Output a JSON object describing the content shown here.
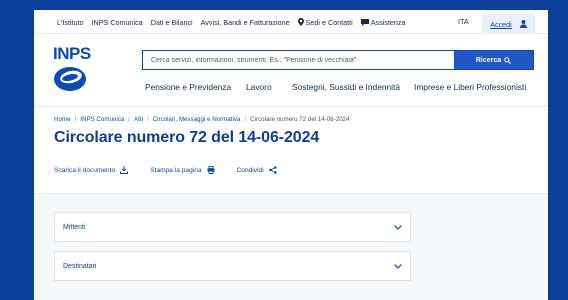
{
  "util": {
    "links": [
      "L'Istituto",
      "INPS Comunica",
      "Dati e Bilanci",
      "Avvisi, Bandi e Fatturazione",
      "Sedi e Contatti",
      "Assistenza"
    ],
    "lang": "ITA",
    "login": "Accedi"
  },
  "logo": {
    "text": "INPS"
  },
  "search": {
    "placeholder": "Cerca servizi, informazioni, strumenti. Es.: \"Pensione di vecchiaia\"",
    "button": "Ricerca"
  },
  "nav": [
    "Pensione e Previdenza",
    "Lavoro",
    "Sostegni, Sussidi e Indennità",
    "Imprese e Liberi Professionisti"
  ],
  "breadcrumb": [
    "Home",
    "INPS Comunica",
    "Atti",
    "Circolari, Messaggi e Normativa",
    "Circolare numero 72 del 14-06-2024"
  ],
  "page": {
    "title": "Circolare numero 72 del 14-06-2024"
  },
  "actions": [
    "Scarica il documento",
    "Stampa la pagina",
    "Condividi"
  ],
  "accordions": [
    "Mittenti",
    "Destinatari"
  ],
  "colors": {
    "brand": "#0b4bb5",
    "background": "#0b3f9a",
    "button": "#1f56c6"
  }
}
